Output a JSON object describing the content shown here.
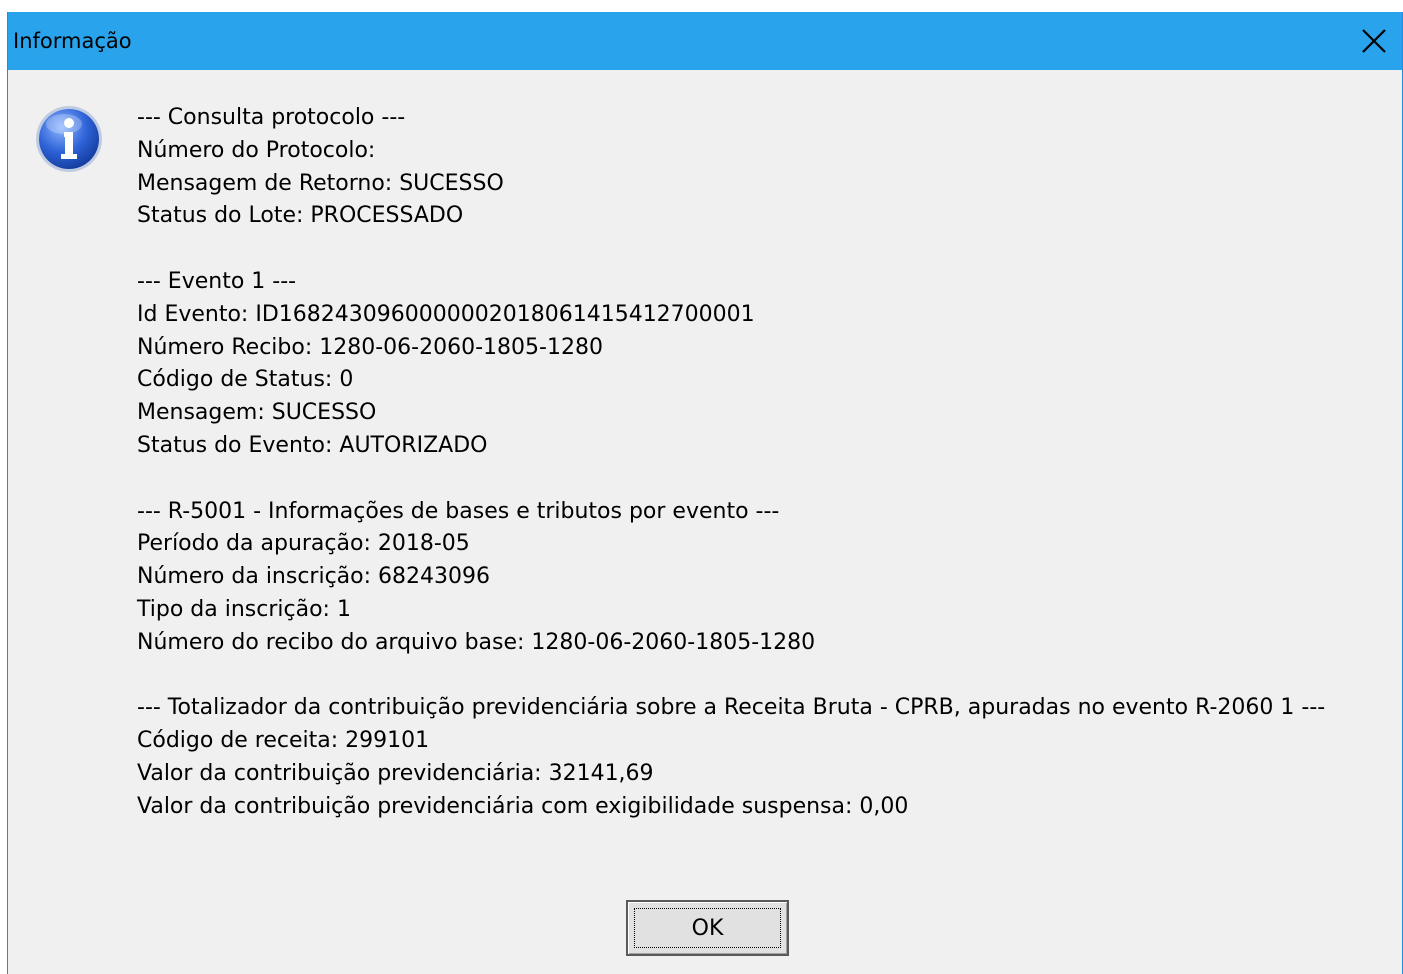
{
  "window": {
    "title": "Informação",
    "close_icon": "close-icon",
    "titlebar_color": "#29a3ec"
  },
  "icon": "info-icon",
  "message": {
    "protocol": {
      "heading": "--- Consulta protocolo ---",
      "numero_protocolo": "Número do Protocolo:",
      "mensagem_retorno": "Mensagem de Retorno: SUCESSO",
      "status_lote": "Status do Lote: PROCESSADO"
    },
    "evento": {
      "heading": "--- Evento 1 ---",
      "id_evento": "Id Evento: ID1682430960000002018061415412700001",
      "numero_recibo": "Número Recibo: 1280-06-2060-1805-1280",
      "codigo_status": "Código de Status: 0",
      "mensagem": "Mensagem: SUCESSO",
      "status_evento": "Status do Evento: AUTORIZADO"
    },
    "r5001": {
      "heading": "--- R-5001 - Informações de bases e tributos por evento ---",
      "periodo": "Período da apuração: 2018-05",
      "numero_inscricao": "Número da inscrição: 68243096",
      "tipo_inscricao": "Tipo da inscrição: 1",
      "numero_recibo_base": "Número do recibo do arquivo base: 1280-06-2060-1805-1280"
    },
    "totalizador": {
      "heading": "--- Totalizador da contribuição previdenciária sobre a Receita Bruta - CPRB, apuradas no evento R-2060 1 ---",
      "codigo_receita": "Código de receita: 299101",
      "valor_contribuicao": "Valor da contribuição previdenciária: 32141,69",
      "valor_suspensa": "Valor da contribuição previdenciária com exigibilidade suspensa: 0,00"
    }
  },
  "buttons": {
    "ok_label": "OK"
  }
}
